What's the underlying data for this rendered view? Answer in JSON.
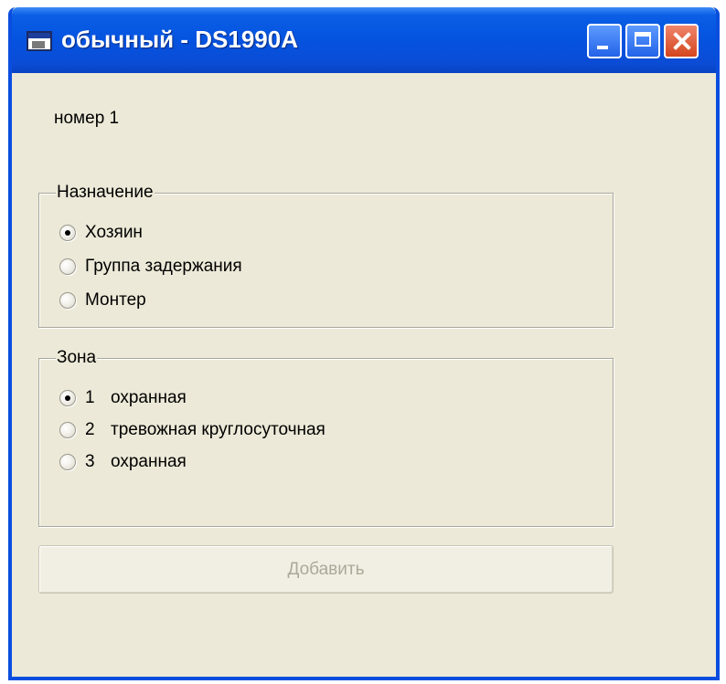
{
  "window": {
    "title": "обычный - DS1990A",
    "accent_color": "#0553e0",
    "background_color": "#ece9d8",
    "icons": [
      "app-window-icon",
      "minimize-icon",
      "maximize-icon",
      "close-icon"
    ]
  },
  "main": {
    "number_label": "номер 1",
    "purpose": {
      "legend": "Назначение",
      "options": [
        {
          "label": "Хозяин",
          "checked": true
        },
        {
          "label": "Группа задержания",
          "checked": false
        },
        {
          "label": "Монтер",
          "checked": false
        }
      ]
    },
    "zone": {
      "legend": "Зона",
      "options": [
        {
          "number": "1",
          "label": "охранная",
          "checked": true
        },
        {
          "number": "2",
          "label": "тревожная круглосуточная",
          "checked": false
        },
        {
          "number": "3",
          "label": "охранная",
          "checked": false
        }
      ]
    },
    "add_button": {
      "label": "Добавить",
      "enabled": false
    }
  }
}
